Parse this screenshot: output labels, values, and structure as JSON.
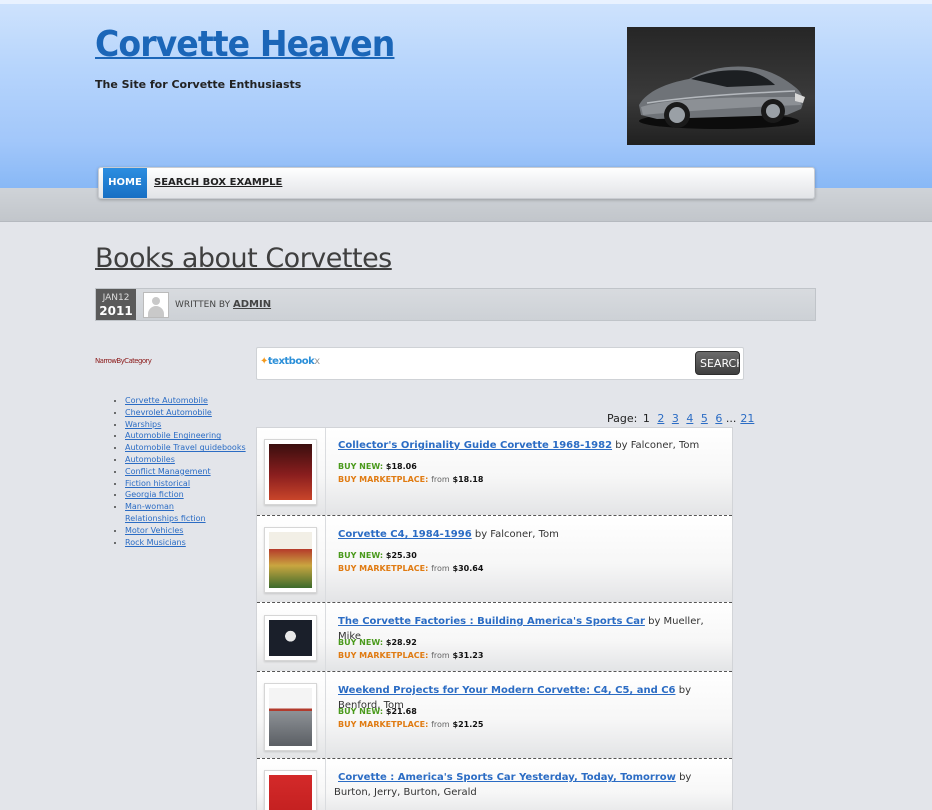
{
  "site": {
    "title": "Corvette Heaven",
    "tagline": "The Site for Corvette Enthusiasts"
  },
  "nav": {
    "items": [
      {
        "label": "HOME",
        "active": true
      },
      {
        "label": "SEARCH BOX EXAMPLE",
        "active": false
      }
    ]
  },
  "post": {
    "title": "Books about Corvettes",
    "date_month_day": "JAN12",
    "date_year": "2011",
    "written_by_label": "WRITTEN BY",
    "author": "ADMIN"
  },
  "sidebar": {
    "heading": "NarrowByCategory",
    "categories": [
      "Corvette Automobile",
      "Chevrolet Automobile",
      "Warships",
      "Automobile Engineering",
      "Automobile Travel  guidebooks",
      "Automobiles",
      "Conflict Management",
      "Fiction  historical",
      "Georgia  fiction",
      "Man-woman",
      "Relationships  fiction",
      "Motor Vehicles",
      "Rock Musicians"
    ]
  },
  "search": {
    "logo_text": "textbook",
    "logo_suffix": "x",
    "button_label": "SEARCH"
  },
  "pager": {
    "label": "Page:",
    "current": "1",
    "pages": [
      "2",
      "3",
      "4",
      "5",
      "6"
    ],
    "ellipsis": "...",
    "last": "21"
  },
  "results": [
    {
      "title": "Collector's Originality Guide Corvette 1968-1982",
      "author": "by Falconer, Tom",
      "buy_new_label": "BUY NEW:",
      "buy_new_price": "$18.06",
      "market_label": "BUY MARKETPLACE:",
      "market_from": "from",
      "market_price": "$18.18"
    },
    {
      "title": "Corvette C4, 1984-1996",
      "author": "by Falconer, Tom",
      "buy_new_label": "BUY NEW:",
      "buy_new_price": "$25.30",
      "market_label": "BUY MARKETPLACE:",
      "market_from": "from",
      "market_price": "$30.64"
    },
    {
      "title": "The Corvette Factories : Building America's Sports Car",
      "author": "by Mueller, Mike",
      "buy_new_label": "BUY NEW:",
      "buy_new_price": "$28.92",
      "market_label": "BUY MARKETPLACE:",
      "market_from": "from",
      "market_price": "$31.23"
    },
    {
      "title": "Weekend Projects for Your Modern Corvette: C4, C5, and C6",
      "author": "by Benford, Tom",
      "buy_new_label": "BUY NEW:",
      "buy_new_price": "$21.68",
      "market_label": "BUY MARKETPLACE:",
      "market_from": "from",
      "market_price": "$21.25"
    },
    {
      "title": "Corvette : America's Sports Car Yesterday, Today, Tomorrow",
      "author": "by Burton, Jerry, Burton, Gerald"
    }
  ],
  "colors": {
    "link": "#2b6cc4",
    "nav_active": "#1f7fd4",
    "buy_new": "#4a9a1c",
    "buy_market": "#e07b12",
    "sidebar_heading": "#8b1a1a"
  }
}
